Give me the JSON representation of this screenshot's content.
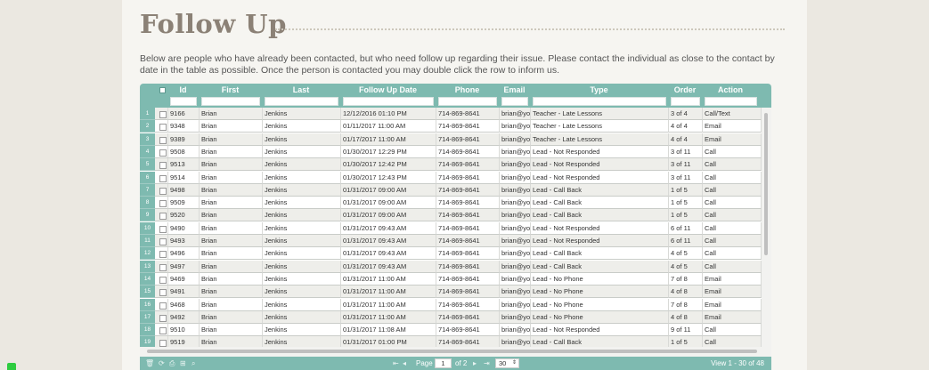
{
  "page": {
    "title": "Follow Up",
    "description": "Below are people who have already been contacted, but who need follow up regarding their issue. Please contact the individual as close to the contact by date in the table as possible. Once the person is contacted you may double click the row to inform us."
  },
  "grid": {
    "columns": [
      "Id",
      "First",
      "Last",
      "Follow Up Date",
      "Phone",
      "Email",
      "Type",
      "Order",
      "Action"
    ],
    "rows": [
      {
        "n": "1",
        "id": "9166",
        "first": "Brian",
        "last": "Jenkins",
        "date": "12/12/2016 01:10 PM",
        "phone": "714-869-8641",
        "email": "brian@you",
        "type": "Teacher - Late Lessons",
        "order": "3 of 4",
        "action": "Call/Text"
      },
      {
        "n": "2",
        "id": "9348",
        "first": "Brian",
        "last": "Jenkins",
        "date": "01/11/2017 11:00 AM",
        "phone": "714-869-8641",
        "email": "brian@you",
        "type": "Teacher - Late Lessons",
        "order": "4 of 4",
        "action": "Email"
      },
      {
        "n": "3",
        "id": "9389",
        "first": "Brian",
        "last": "Jenkins",
        "date": "01/17/2017 11:00 AM",
        "phone": "714-869-8641",
        "email": "brian@you",
        "type": "Teacher - Late Lessons",
        "order": "4 of 4",
        "action": "Email"
      },
      {
        "n": "4",
        "id": "9508",
        "first": "Brian",
        "last": "Jenkins",
        "date": "01/30/2017 12:29 PM",
        "phone": "714-869-8641",
        "email": "brian@you",
        "type": "Lead - Not Responded",
        "order": "3 of 11",
        "action": "Call"
      },
      {
        "n": "5",
        "id": "9513",
        "first": "Brian",
        "last": "Jenkins",
        "date": "01/30/2017 12:42 PM",
        "phone": "714-869-8641",
        "email": "brian@you",
        "type": "Lead - Not Responded",
        "order": "3 of 11",
        "action": "Call"
      },
      {
        "n": "6",
        "id": "9514",
        "first": "Brian",
        "last": "Jenkins",
        "date": "01/30/2017 12:43 PM",
        "phone": "714-869-8641",
        "email": "brian@you",
        "type": "Lead - Not Responded",
        "order": "3 of 11",
        "action": "Call"
      },
      {
        "n": "7",
        "id": "9498",
        "first": "Brian",
        "last": "Jenkins",
        "date": "01/31/2017 09:00 AM",
        "phone": "714-869-8641",
        "email": "brian@you",
        "type": "Lead - Call Back",
        "order": "1 of 5",
        "action": "Call"
      },
      {
        "n": "8",
        "id": "9509",
        "first": "Brian",
        "last": "Jenkins",
        "date": "01/31/2017 09:00 AM",
        "phone": "714-869-8641",
        "email": "brian@you",
        "type": "Lead - Call Back",
        "order": "1 of 5",
        "action": "Call"
      },
      {
        "n": "9",
        "id": "9520",
        "first": "Brian",
        "last": "Jenkins",
        "date": "01/31/2017 09:00 AM",
        "phone": "714-869-8641",
        "email": "brian@you",
        "type": "Lead - Call Back",
        "order": "1 of 5",
        "action": "Call"
      },
      {
        "n": "10",
        "id": "9490",
        "first": "Brian",
        "last": "Jenkins",
        "date": "01/31/2017 09:43 AM",
        "phone": "714-869-8641",
        "email": "brian@you",
        "type": "Lead - Not Responded",
        "order": "6 of 11",
        "action": "Call"
      },
      {
        "n": "11",
        "id": "9493",
        "first": "Brian",
        "last": "Jenkins",
        "date": "01/31/2017 09:43 AM",
        "phone": "714-869-8641",
        "email": "brian@you",
        "type": "Lead - Not Responded",
        "order": "6 of 11",
        "action": "Call"
      },
      {
        "n": "12",
        "id": "9496",
        "first": "Brian",
        "last": "Jenkins",
        "date": "01/31/2017 09:43 AM",
        "phone": "714-869-8641",
        "email": "brian@you",
        "type": "Lead - Call Back",
        "order": "4 of 5",
        "action": "Call"
      },
      {
        "n": "13",
        "id": "9497",
        "first": "Brian",
        "last": "Jenkins",
        "date": "01/31/2017 09:43 AM",
        "phone": "714-869-8641",
        "email": "brian@you",
        "type": "Lead - Call Back",
        "order": "4 of 5",
        "action": "Call"
      },
      {
        "n": "14",
        "id": "9469",
        "first": "Brian",
        "last": "Jenkins",
        "date": "01/31/2017 11:00 AM",
        "phone": "714-869-8641",
        "email": "brian@you",
        "type": "Lead - No Phone",
        "order": "7 of 8",
        "action": "Email"
      },
      {
        "n": "15",
        "id": "9491",
        "first": "Brian",
        "last": "Jenkins",
        "date": "01/31/2017 11:00 AM",
        "phone": "714-869-8641",
        "email": "brian@you",
        "type": "Lead - No Phone",
        "order": "4 of 8",
        "action": "Email"
      },
      {
        "n": "16",
        "id": "9468",
        "first": "Brian",
        "last": "Jenkins",
        "date": "01/31/2017 11:00 AM",
        "phone": "714-869-8641",
        "email": "brian@you",
        "type": "Lead - No Phone",
        "order": "7 of 8",
        "action": "Email"
      },
      {
        "n": "17",
        "id": "9492",
        "first": "Brian",
        "last": "Jenkins",
        "date": "01/31/2017 11:00 AM",
        "phone": "714-869-8641",
        "email": "brian@you",
        "type": "Lead - No Phone",
        "order": "4 of 8",
        "action": "Email"
      },
      {
        "n": "18",
        "id": "9510",
        "first": "Brian",
        "last": "Jenkins",
        "date": "01/31/2017 11:08 AM",
        "phone": "714-869-8641",
        "email": "brian@you",
        "type": "Lead - Not Responded",
        "order": "9 of 11",
        "action": "Call"
      },
      {
        "n": "19",
        "id": "9519",
        "first": "Brian",
        "last": "Jenkins",
        "date": "01/31/2017 01:00 PM",
        "phone": "714-869-8641",
        "email": "brian@you",
        "type": "Lead - Call Back",
        "order": "1 of 5",
        "action": "Call"
      }
    ]
  },
  "pager": {
    "page_label": "Page",
    "page_value": "1",
    "of_label": "of 2",
    "page_size": "30",
    "view_text": "View 1 - 30 of 48",
    "icons": [
      "trash-icon",
      "refresh-icon",
      "print-icon",
      "column-chooser-icon",
      "search-icon",
      "first-page-icon",
      "prev-page-icon",
      "next-page-icon",
      "last-page-icon"
    ]
  },
  "colors": {
    "accent": "#7ebab0",
    "title": "#8b8176",
    "row_alt": "#eeeeea"
  }
}
